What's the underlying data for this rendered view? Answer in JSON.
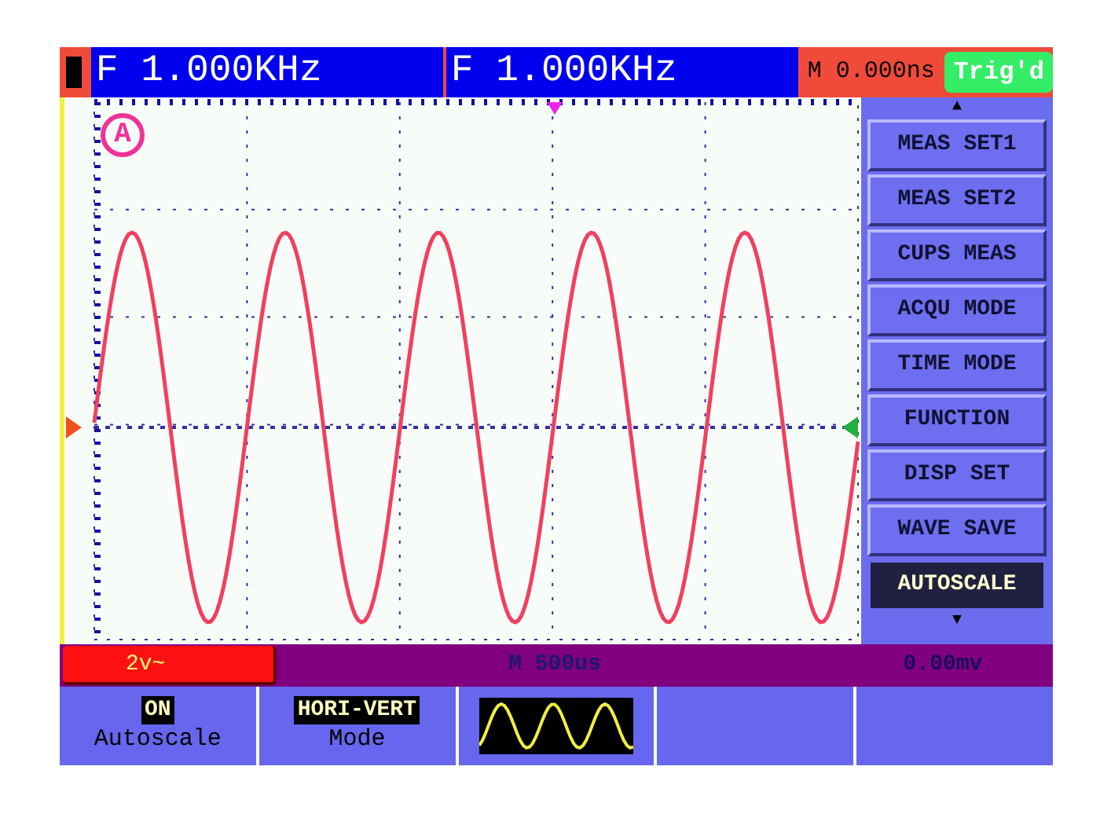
{
  "top_bar": {
    "readouts": [
      "F 1.000KHz",
      "F 1.000KHz"
    ],
    "time_offset": "M 0.000ns",
    "trigger_status": "Trig'd"
  },
  "plot": {
    "channel_marker": "A"
  },
  "menu": {
    "up_arrow": "▲",
    "down_arrow": "▼",
    "items": [
      {
        "label": "MEAS SET1",
        "selected": false
      },
      {
        "label": "MEAS SET2",
        "selected": false
      },
      {
        "label": "CUPS MEAS",
        "selected": false
      },
      {
        "label": "ACQU MODE",
        "selected": false
      },
      {
        "label": "TIME MODE",
        "selected": false
      },
      {
        "label": "FUNCTION",
        "selected": false
      },
      {
        "label": "DISP SET",
        "selected": false
      },
      {
        "label": "WAVE SAVE",
        "selected": false
      },
      {
        "label": "AUTOSCALE",
        "selected": true
      }
    ]
  },
  "status_bar": {
    "channel_scale": "2v~",
    "timebase": "M 500us",
    "trigger_level": "0.00mv"
  },
  "soft_keys": [
    {
      "kind": "text",
      "value": "ON",
      "label": "Autoscale"
    },
    {
      "kind": "text",
      "value": "HORI-VERT",
      "label": "Mode"
    },
    {
      "kind": "wave"
    },
    {
      "kind": "empty"
    },
    {
      "kind": "empty"
    }
  ]
}
